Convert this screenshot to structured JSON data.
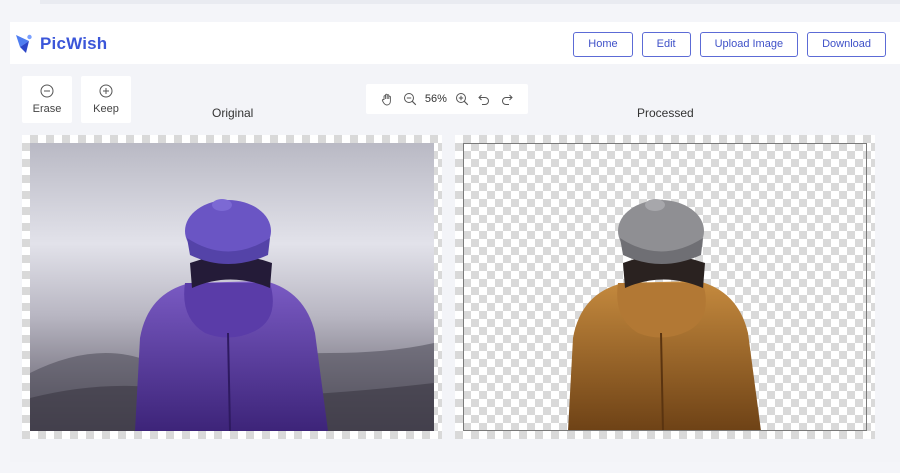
{
  "header": {
    "brand": "PicWish",
    "nav": [
      {
        "label": "Home"
      },
      {
        "label": "Edit"
      },
      {
        "label": "Upload Image"
      },
      {
        "label": "Download"
      }
    ]
  },
  "tools": {
    "erase": {
      "label": "Erase",
      "icon": "minus-circle-icon"
    },
    "keep": {
      "label": "Keep",
      "icon": "plus-circle-icon"
    }
  },
  "zoom": {
    "level": "56%",
    "icons": [
      "hand-icon",
      "zoom-out-icon",
      "zoom-in-icon",
      "undo-icon",
      "redo-icon"
    ]
  },
  "panes": {
    "original": {
      "title": "Original"
    },
    "processed": {
      "title": "Processed"
    }
  },
  "colors": {
    "brand": "#3b56d9",
    "nav_border": "#5c6bd6",
    "jacket_original": "#5b3aa8",
    "jacket_processed": "#a86b2a"
  }
}
